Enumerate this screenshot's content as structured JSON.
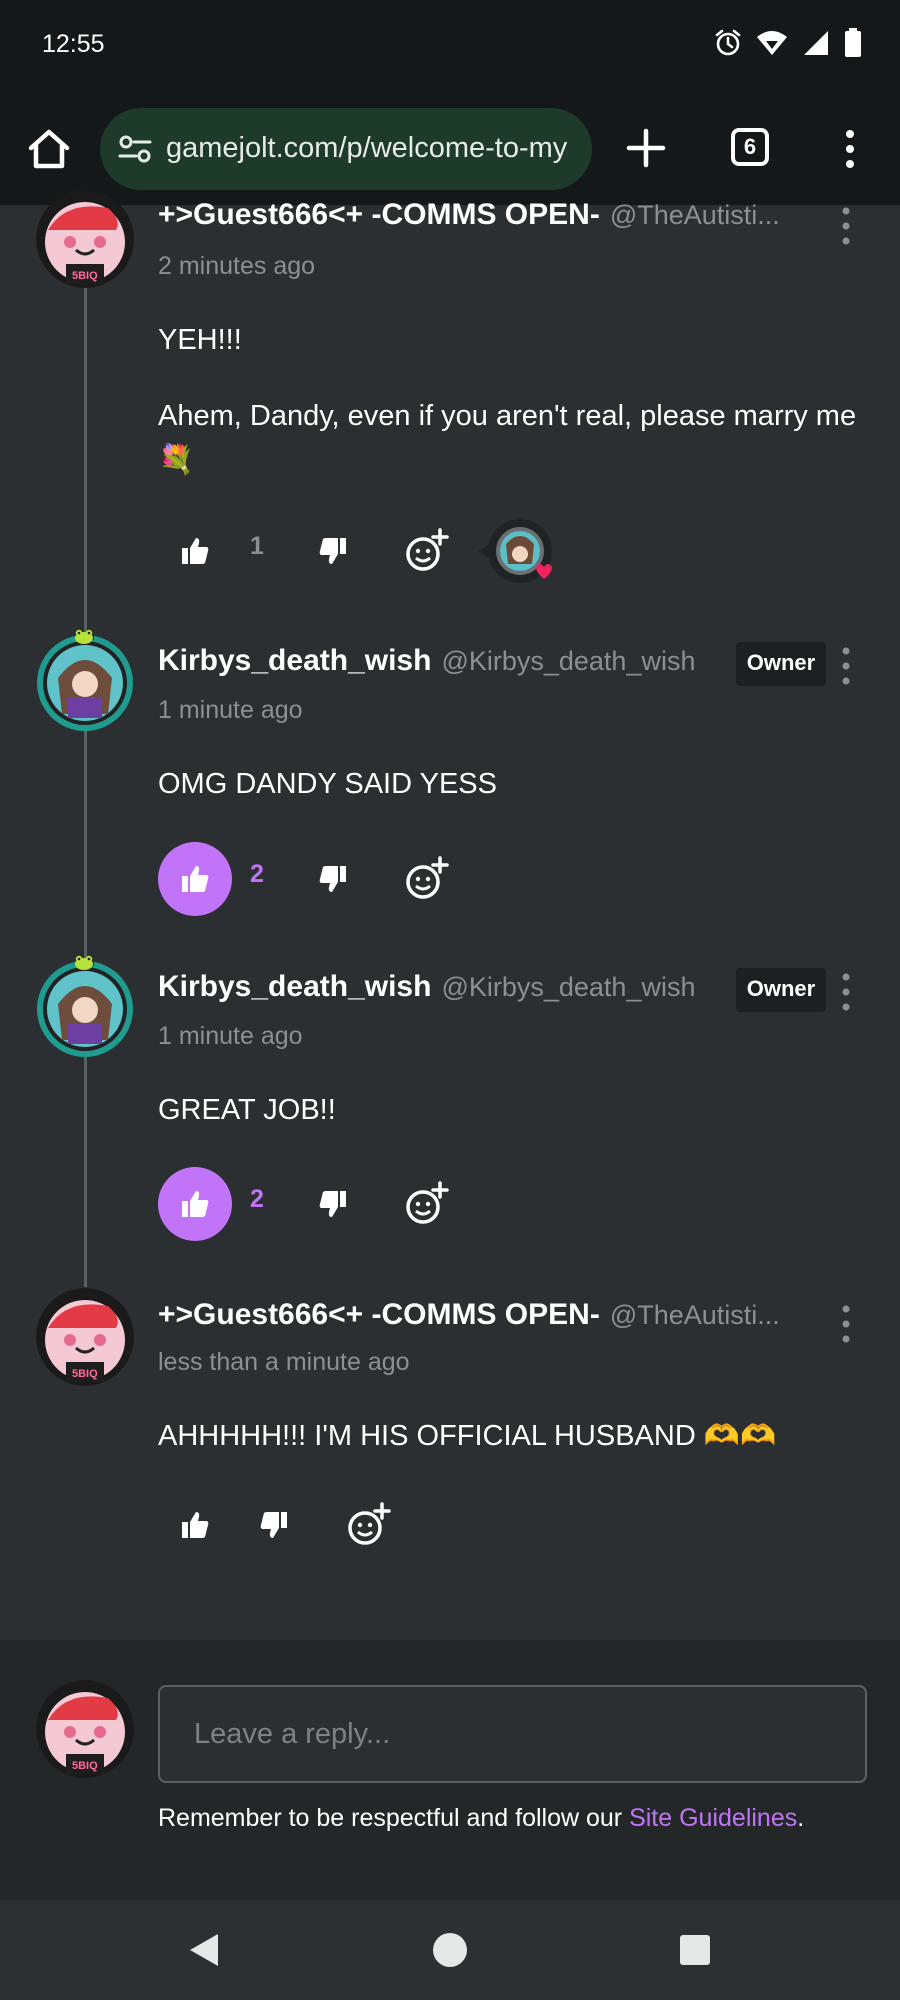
{
  "status_bar": {
    "time": "12:55"
  },
  "browser": {
    "url": "gamejolt.com/p/welcome-to-my",
    "tab_count": "6"
  },
  "comments": [
    {
      "author": "+>Guest666<+ -COMMS OPEN-",
      "handle": "@TheAutisti...",
      "time": "2 minutes ago",
      "body": [
        "YEH!!!",
        "Ahem, Dandy, even if you aren't real, please marry me 💐"
      ],
      "likes": "1",
      "liked": false
    },
    {
      "author": "Kirbys_death_wish",
      "handle": "@Kirbys_death_wish",
      "badge": "Owner",
      "time": "1 minute ago",
      "body": [
        "OMG DANDY SAID YESS"
      ],
      "likes": "2",
      "liked": true
    },
    {
      "author": "Kirbys_death_wish",
      "handle": "@Kirbys_death_wish",
      "badge": "Owner",
      "time": "1 minute ago",
      "body": [
        "GREAT JOB!!"
      ],
      "likes": "2",
      "liked": true
    },
    {
      "author": "+>Guest666<+ -COMMS OPEN-",
      "handle": "@TheAutisti...",
      "time": "less than a minute ago",
      "body": [
        "AHHHHH!!! I'M HIS OFFICIAL HUSBAND 🫶🫶"
      ],
      "likes": "",
      "liked": false
    }
  ],
  "reply": {
    "placeholder": "Leave a reply...",
    "guidelines_prefix": "Remember to be respectful and follow our ",
    "guidelines_link": "Site Guidelines",
    "guidelines_suffix": "."
  },
  "colors": {
    "accent": "#c274f8",
    "background": "#2b2f31",
    "muted_text": "#8a9094"
  }
}
